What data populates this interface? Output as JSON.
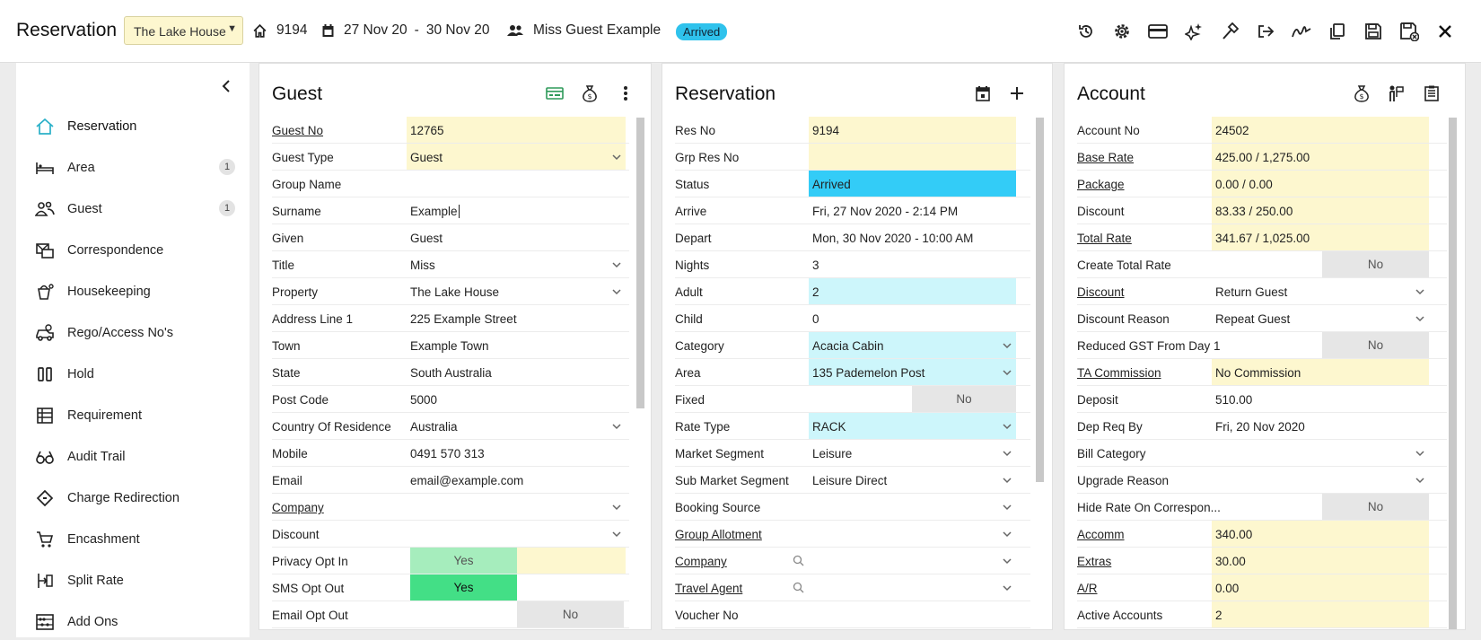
{
  "header": {
    "title": "Reservation",
    "property": "The Lake House",
    "area_no": "9194",
    "date_from": "27 Nov 20",
    "date_sep": "-",
    "date_to": "30 Nov 20",
    "guest_name": "Miss Guest Example",
    "status": "Arrived",
    "toolbar_icons": [
      "history-icon",
      "gear-icon",
      "credit-card-icon",
      "sparkle-icon",
      "hammer-icon",
      "sign-out-icon",
      "signature-icon",
      "copy-icon",
      "save-icon",
      "save-close-icon",
      "close-icon"
    ]
  },
  "sidebar": {
    "items": [
      {
        "label": "Reservation",
        "icon": "home-icon",
        "active": true
      },
      {
        "label": "Area",
        "icon": "bed-icon",
        "count": "1"
      },
      {
        "label": "Guest",
        "icon": "users-icon",
        "count": "1"
      },
      {
        "label": "Correspondence",
        "icon": "mail-icon"
      },
      {
        "label": "Housekeeping",
        "icon": "bucket-icon"
      },
      {
        "label": "Rego/Access No's",
        "icon": "car-icon"
      },
      {
        "label": "Hold",
        "icon": "pause-icon"
      },
      {
        "label": "Requirement",
        "icon": "list-icon"
      },
      {
        "label": "Audit Trail",
        "icon": "glasses-icon"
      },
      {
        "label": "Charge Redirection",
        "icon": "diamond-icon"
      },
      {
        "label": "Encashment",
        "icon": "cart-icon"
      },
      {
        "label": "Split Rate",
        "icon": "split-icon"
      },
      {
        "label": "Add Ons",
        "icon": "abacus-icon"
      }
    ]
  },
  "guest": {
    "title": "Guest",
    "rows": [
      {
        "label": "Guest No",
        "value": "12765"
      },
      {
        "label": "Guest Type",
        "value": "Guest"
      },
      {
        "label": "Group Name",
        "value": ""
      },
      {
        "label": "Surname",
        "value": "Example"
      },
      {
        "label": "Given",
        "value": "Guest"
      },
      {
        "label": "Title",
        "value": "Miss"
      },
      {
        "label": "Property",
        "value": "The Lake House"
      },
      {
        "label": "Address Line 1",
        "value": "225 Example Street"
      },
      {
        "label": "Town",
        "value": "Example Town"
      },
      {
        "label": "State",
        "value": "South Australia"
      },
      {
        "label": "Post Code",
        "value": "5000"
      },
      {
        "label": "Country Of Residence",
        "value": "Australia"
      },
      {
        "label": "Mobile",
        "value": "0491 570 313"
      },
      {
        "label": "Email",
        "value": "email@example.com"
      },
      {
        "label": "Company",
        "value": ""
      },
      {
        "label": "Discount",
        "value": ""
      },
      {
        "label": "Privacy Opt In",
        "value": "Yes"
      },
      {
        "label": "SMS Opt Out",
        "value": "Yes"
      },
      {
        "label": "Email Opt Out",
        "value": "No"
      }
    ]
  },
  "reservation": {
    "title": "Reservation",
    "rows": [
      {
        "label": "Res No",
        "value": "9194"
      },
      {
        "label": "Grp Res No",
        "value": ""
      },
      {
        "label": "Status",
        "value": "Arrived"
      },
      {
        "label": "Arrive",
        "value": "Fri, 27 Nov 2020 - 2:14 PM"
      },
      {
        "label": "Depart",
        "value": "Mon, 30 Nov 2020 - 10:00 AM"
      },
      {
        "label": "Nights",
        "value": "3"
      },
      {
        "label": "Adult",
        "value": "2"
      },
      {
        "label": "Child",
        "value": "0"
      },
      {
        "label": "Category",
        "value": "Acacia Cabin"
      },
      {
        "label": "Area",
        "value": "135 Pademelon Post"
      },
      {
        "label": "Fixed",
        "value": "No"
      },
      {
        "label": "Rate Type",
        "value": "RACK"
      },
      {
        "label": "Market Segment",
        "value": "Leisure"
      },
      {
        "label": "Sub Market Segment",
        "value": "Leisure Direct"
      },
      {
        "label": "Booking Source",
        "value": ""
      },
      {
        "label": "Group Allotment",
        "value": ""
      },
      {
        "label": "Company",
        "value": ""
      },
      {
        "label": "Travel Agent",
        "value": ""
      },
      {
        "label": "Voucher No",
        "value": ""
      }
    ]
  },
  "account": {
    "title": "Account",
    "rows": [
      {
        "label": "Account No",
        "value": "24502"
      },
      {
        "label": "Base Rate",
        "value": "425.00 / 1,275.00"
      },
      {
        "label": "Package",
        "value": "0.00 / 0.00"
      },
      {
        "label": "Discount",
        "value": "83.33 / 250.00"
      },
      {
        "label": "Total Rate",
        "value": "341.67 / 1,025.00"
      },
      {
        "label": "Create Total Rate",
        "value": "No"
      },
      {
        "label": "Discount",
        "value": "Return Guest"
      },
      {
        "label": "Discount Reason",
        "value": "Repeat Guest"
      },
      {
        "label": "Reduced GST From Day 1",
        "value": "No"
      },
      {
        "label": "TA Commission",
        "value": "No Commission"
      },
      {
        "label": "Deposit",
        "value": "510.00"
      },
      {
        "label": "Dep Req By",
        "value": "Fri, 20 Nov 2020"
      },
      {
        "label": "Bill Category",
        "value": ""
      },
      {
        "label": "Upgrade Reason",
        "value": ""
      },
      {
        "label": "Hide Rate On Correspon...",
        "value": "No"
      },
      {
        "label": "Accomm",
        "value": "340.00"
      },
      {
        "label": "Extras",
        "value": "30.00"
      },
      {
        "label": "A/R",
        "value": "0.00"
      },
      {
        "label": "Active Accounts",
        "value": "2"
      }
    ]
  },
  "colors": {
    "status_badge": "#2fc2ec",
    "yellow_field": "#fdf7cf",
    "cyan_field": "#cdf6fb",
    "status_field": "#33ccf7",
    "toggle_yes": "#43df86"
  }
}
